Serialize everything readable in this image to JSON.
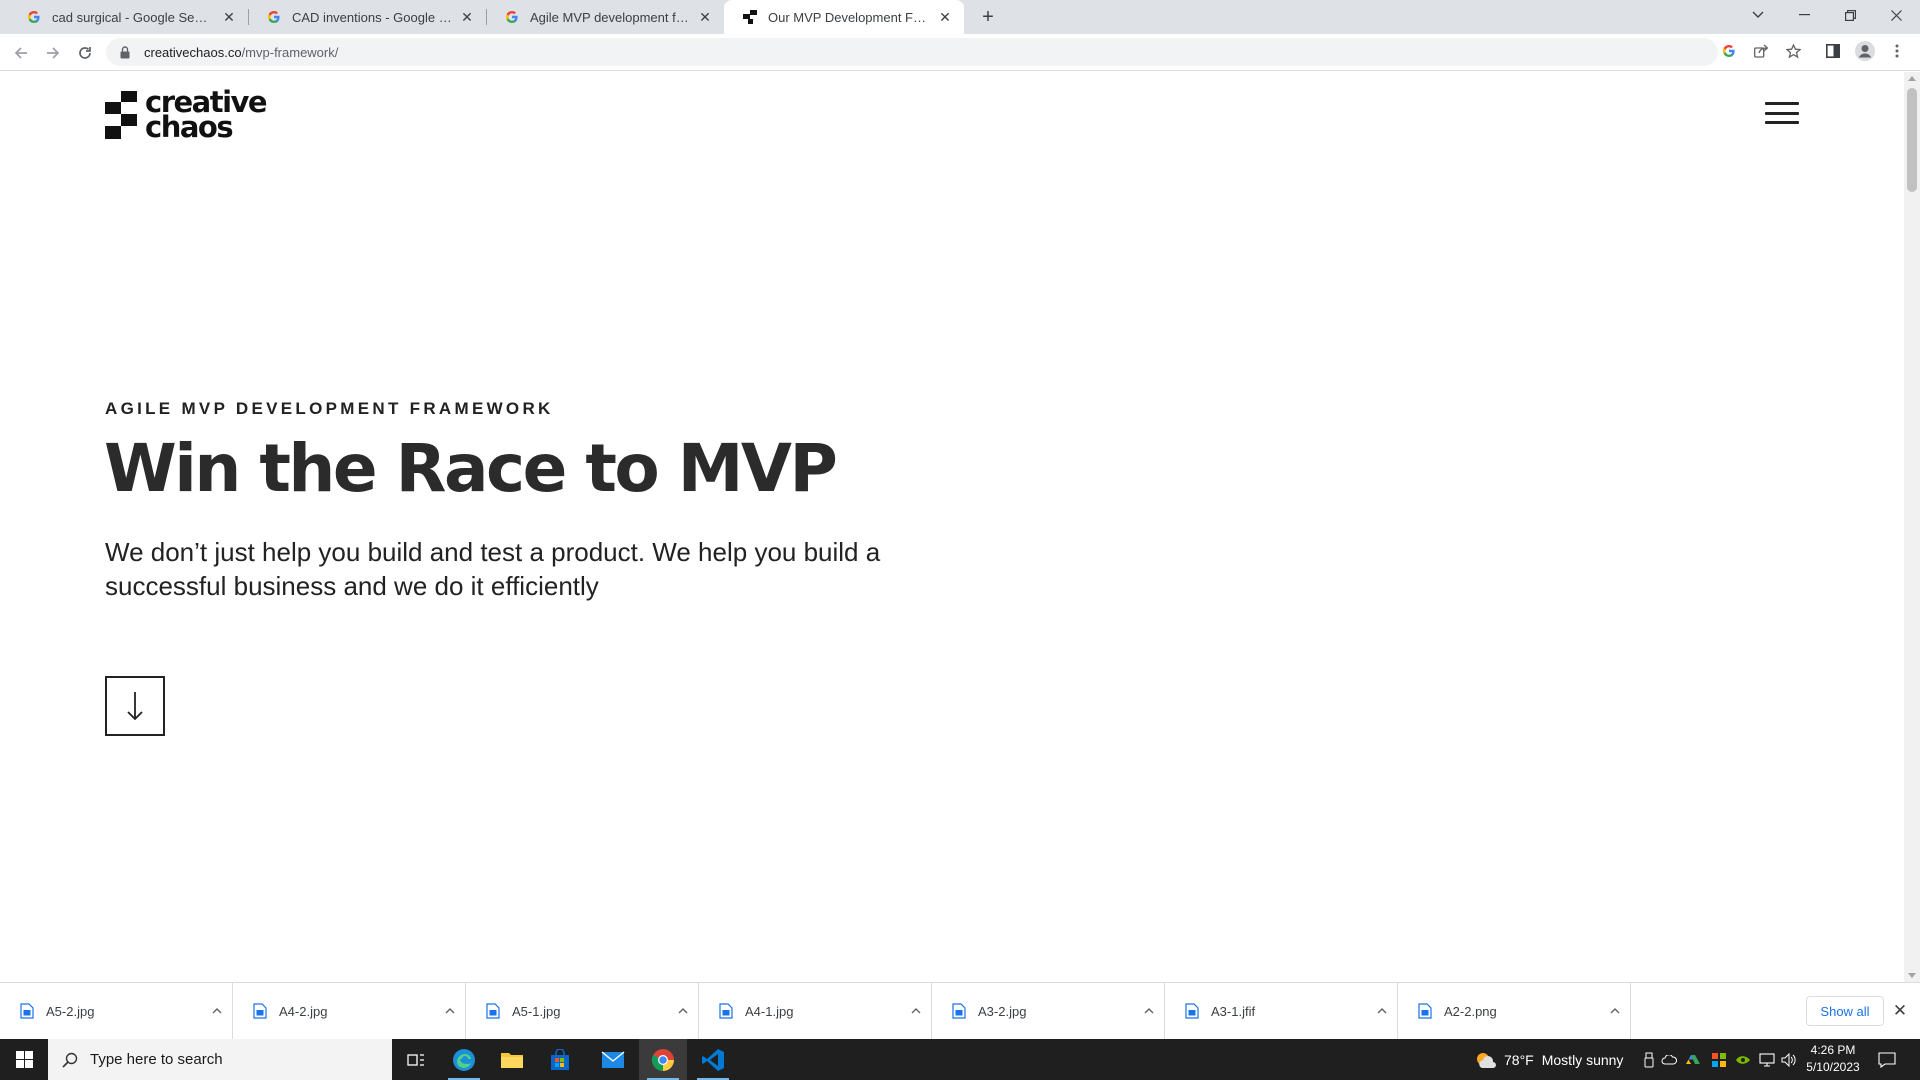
{
  "browser": {
    "tabs": [
      {
        "title": "cad surgical - Google Search",
        "favicon": "google-icon",
        "active": false
      },
      {
        "title": "CAD inventions - Google Search",
        "favicon": "google-icon",
        "active": false
      },
      {
        "title": "Agile MVP development framework",
        "favicon": "google-icon",
        "active": false
      },
      {
        "title": "Our MVP Development Framework",
        "favicon": "creative-chaos-icon",
        "active": true
      }
    ],
    "url_host": "creativechaos.co",
    "url_path": "/mvp-framework/"
  },
  "page": {
    "logo_line1": "creative",
    "logo_line2": "chaos",
    "eyebrow": "AGILE MVP DEVELOPMENT FRAMEWORK",
    "headline": "Win the Race to MVP",
    "lede": "We don’t just help you build and test a product. We help you build a successful business and we do it efficiently"
  },
  "downloads": {
    "items": [
      {
        "name": "A5-2.jpg"
      },
      {
        "name": "A4-2.jpg"
      },
      {
        "name": "A5-1.jpg"
      },
      {
        "name": "A4-1.jpg"
      },
      {
        "name": "A3-2.jpg"
      },
      {
        "name": "A3-1.jfif"
      },
      {
        "name": "A2-2.png"
      }
    ],
    "show_all_label": "Show all"
  },
  "taskbar": {
    "search_placeholder": "Type here to search",
    "weather_temp": "78°F",
    "weather_text": "Mostly sunny",
    "time": "4:26 PM",
    "date": "5/10/2023"
  },
  "colors": {
    "tabstrip_bg": "#dee1e6",
    "link_blue": "#1a73e8",
    "taskbar_bg": "#1f1f1f"
  }
}
